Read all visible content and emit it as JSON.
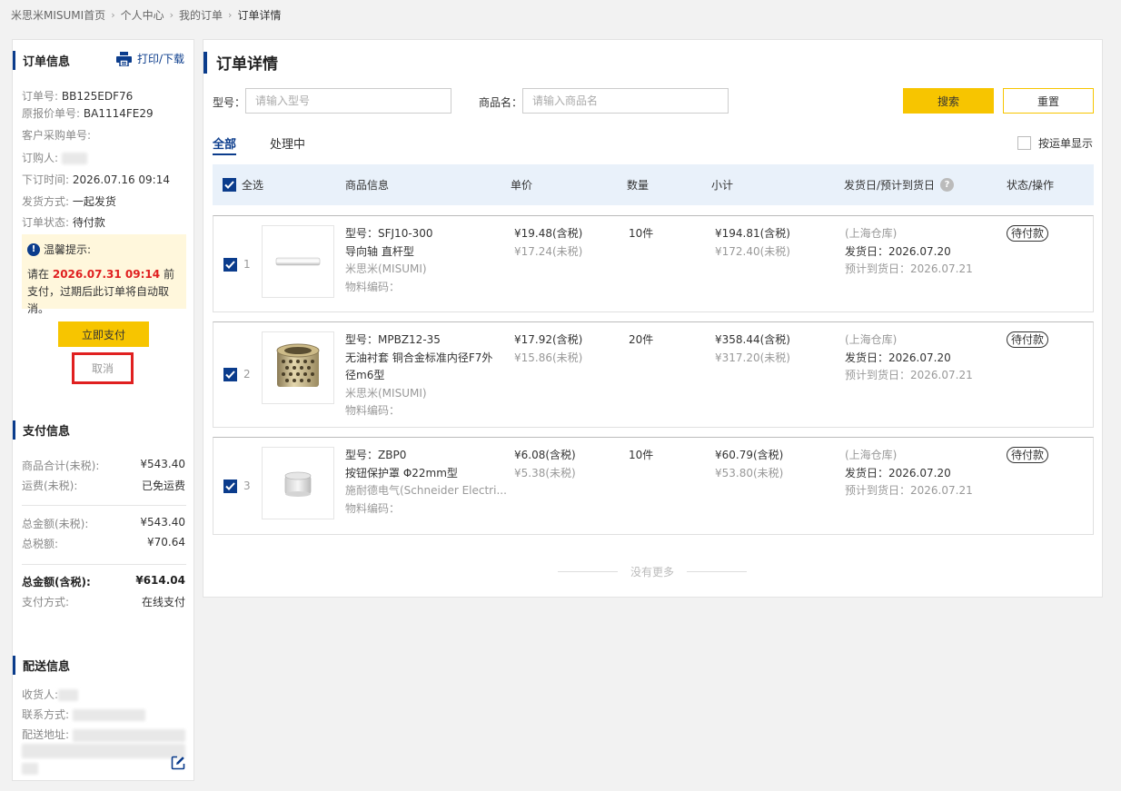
{
  "breadcrumb": [
    "米思米MISUMI首页",
    "个人中心",
    "我的订单",
    "订单详情"
  ],
  "order_info": {
    "title": "订单信息",
    "print_label": "打印/下载",
    "order_no_label": "订单号:",
    "order_no": "BB125EDF76",
    "quote_no_label": "原报价单号:",
    "quote_no": "BA1114FE29",
    "customer_po_label": "客户采购单号:",
    "buyer_label": "订购人:",
    "order_time_label": "下订时间:",
    "order_time": "2026.07.16 09:14",
    "shipping_method_label": "发货方式:",
    "shipping_method": "一起发货",
    "status_label": "订单状态:",
    "status": "待付款"
  },
  "notice": {
    "title": "温馨提示:",
    "text_before": "请在",
    "deadline": "2026.07.31 09:14",
    "text_after": "前支付，过期后此订单将自动取消。"
  },
  "actions": {
    "pay": "立即支付",
    "cancel": "取消"
  },
  "payment": {
    "title": "支付信息",
    "rows": [
      {
        "label": "商品合计(未税):",
        "value": "¥543.40"
      },
      {
        "label": "运费(未税):",
        "value": "已免运费"
      },
      {
        "label": "总金额(未税):",
        "value": "¥543.40"
      },
      {
        "label": "总税额:",
        "value": "¥70.64"
      },
      {
        "label": "总金额(含税):",
        "value": "¥614.04"
      },
      {
        "label": "支付方式:",
        "value": "在线支付"
      }
    ]
  },
  "delivery": {
    "title": "配送信息",
    "recipient_label": "收货人:",
    "contact_label": "联系方式:",
    "address_label": "配送地址:"
  },
  "main": {
    "title": "订单详情",
    "model_label": "型号：",
    "model_placeholder": "请输入型号",
    "product_label": "商品名：",
    "product_placeholder": "请输入商品名",
    "search": "搜索",
    "reset": "重置",
    "tabs": [
      "全部",
      "处理中"
    ],
    "waybill": "按运单显示",
    "headers": {
      "select_all": "全选",
      "product": "商品信息",
      "price": "单价",
      "qty": "数量",
      "subtotal": "小计",
      "ship_date": "发货日/预计到货日",
      "status": "状态/操作"
    },
    "items": [
      {
        "idx": "1",
        "model": "型号：SFJ10-300",
        "name": "导向轴 直杆型",
        "brand": "米思米(MISUMI)",
        "material_code": "物料编码：",
        "price_tax": "¥19.48(含税)",
        "price_notax": "¥17.24(未税)",
        "qty": "10件",
        "sub_tax": "¥194.81(含税)",
        "sub_notax": "¥172.40(未税)",
        "warehouse": "(上海仓库)",
        "ship": "发货日：2026.07.20",
        "arrive": "预计到货日：2026.07.21",
        "status": "待付款"
      },
      {
        "idx": "2",
        "model": "型号：MPBZ12-35",
        "name1": "无油衬套 铜合金标准内径F7外",
        "name2": "径m6型",
        "brand": "米思米(MISUMI)",
        "material_code": "物料编码：",
        "price_tax": "¥17.92(含税)",
        "price_notax": "¥15.86(未税)",
        "qty": "20件",
        "sub_tax": "¥358.44(含税)",
        "sub_notax": "¥317.20(未税)",
        "warehouse": "(上海仓库)",
        "ship": "发货日：2026.07.20",
        "arrive": "预计到货日：2026.07.21",
        "status": "待付款"
      },
      {
        "idx": "3",
        "model": "型号：ZBP0",
        "name": "按钮保护罩 Φ22mm型",
        "brand": "施耐德电气(Schneider Electri...",
        "material_code": "物料编码：",
        "price_tax": "¥6.08(含税)",
        "price_notax": "¥5.38(未税)",
        "qty": "10件",
        "sub_tax": "¥60.79(含税)",
        "sub_notax": "¥53.80(未税)",
        "warehouse": "(上海仓库)",
        "ship": "发货日：2026.07.20",
        "arrive": "预计到货日：2026.07.21",
        "status": "待付款"
      }
    ],
    "no_more": "没有更多"
  },
  "colors": {
    "accent": "#0b3c8c",
    "yellow": "#f7c500",
    "red": "#e02020"
  }
}
